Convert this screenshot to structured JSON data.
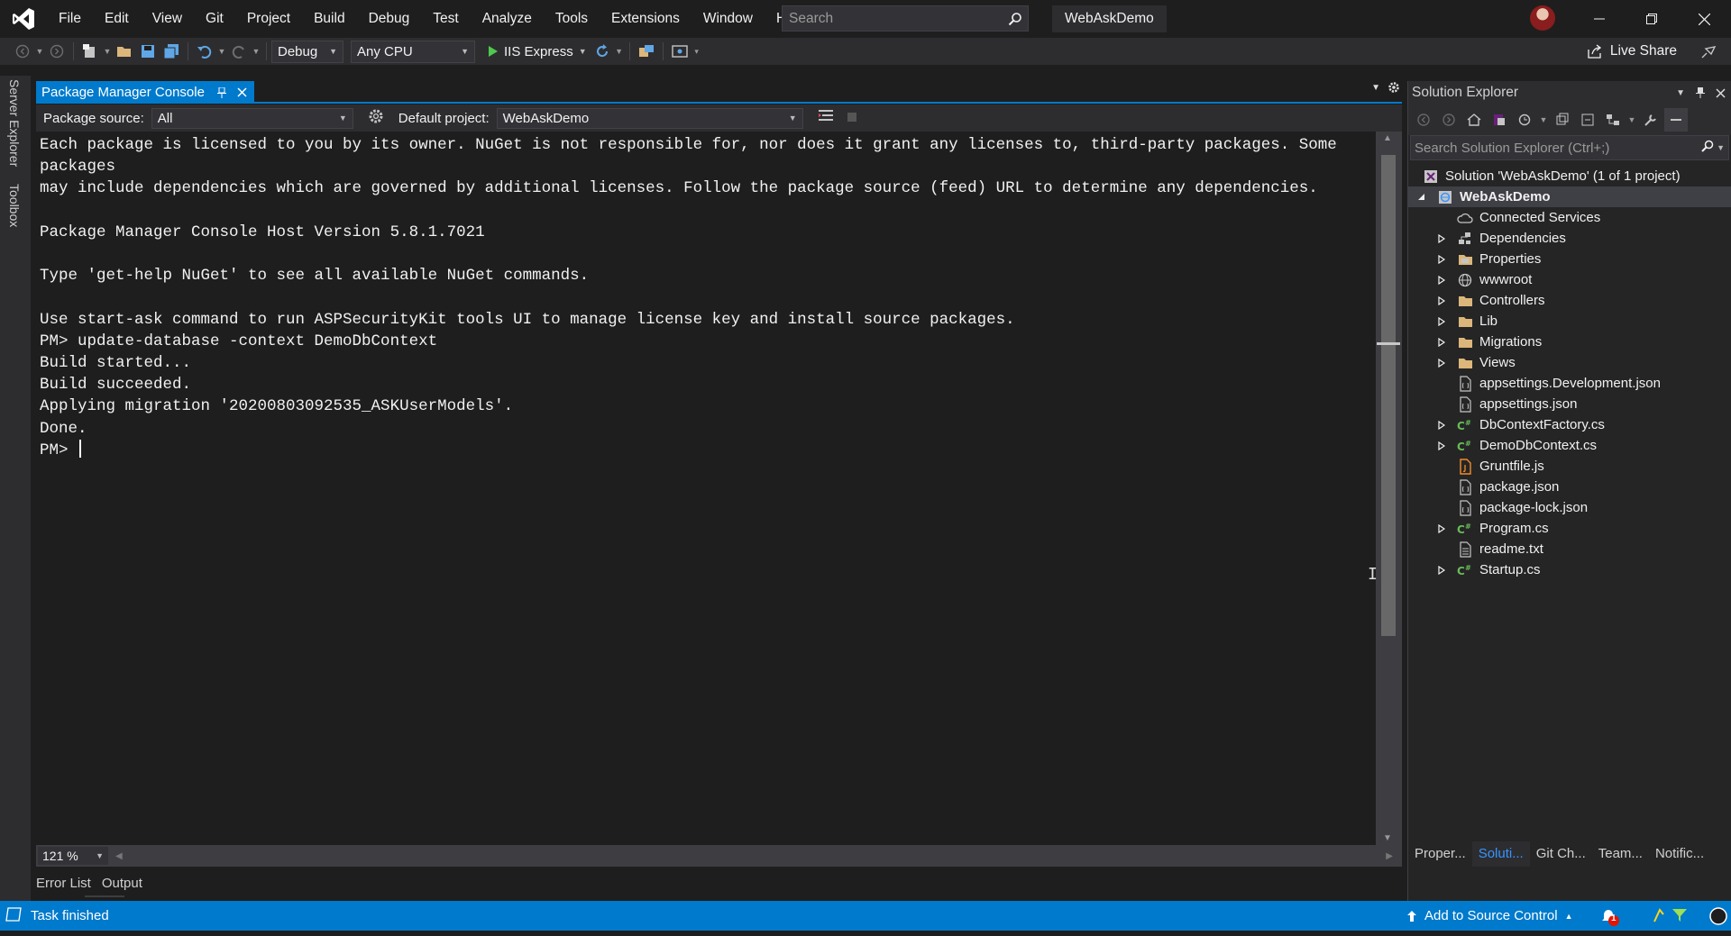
{
  "menu": [
    "File",
    "Edit",
    "View",
    "Git",
    "Project",
    "Build",
    "Debug",
    "Test",
    "Analyze",
    "Tools",
    "Extensions",
    "Window",
    "Help"
  ],
  "search": {
    "placeholder": "Search"
  },
  "solution_name": "WebAskDemo",
  "toolbar": {
    "config": "Debug",
    "platform": "Any CPU",
    "run_label": "IIS Express",
    "live_share": "Live Share"
  },
  "left_strip": {
    "server_explorer": "Server Explorer",
    "toolbox": "Toolbox"
  },
  "pmc": {
    "tab_title": "Package Manager Console",
    "package_source_label": "Package source:",
    "package_source_value": "All",
    "default_project_label": "Default project:",
    "default_project_value": "WebAskDemo",
    "zoom": "121 %",
    "lines": [
      "Each package is licensed to you by its owner. NuGet is not responsible for, nor does it grant any licenses to, third-party packages. Some packages",
      "may include dependencies which are governed by additional licenses. Follow the package source (feed) URL to determine any dependencies.",
      "",
      "Package Manager Console Host Version 5.8.1.7021",
      "",
      "Type 'get-help NuGet' to see all available NuGet commands.",
      "",
      "Use start-ask command to run ASPSecurityKit tools UI to manage license key and install source packages.",
      "PM> update-database -context DemoDbContext",
      "Build started...",
      "Build succeeded.",
      "Applying migration '20200803092535_ASKUserModels'.",
      "Done.",
      "PM> "
    ]
  },
  "bottom_tabs": [
    "Error List",
    "Output"
  ],
  "solution_explorer": {
    "title": "Solution Explorer",
    "search_placeholder": "Search Solution Explorer (Ctrl+;)",
    "solution_label": "Solution 'WebAskDemo' (1 of 1 project)",
    "project_label": "WebAskDemo",
    "items": [
      {
        "label": "Connected Services",
        "icon": "connected-services-icon",
        "expandable": false
      },
      {
        "label": "Dependencies",
        "icon": "dependencies-icon",
        "expandable": true
      },
      {
        "label": "Properties",
        "icon": "properties-folder-icon",
        "expandable": true
      },
      {
        "label": "wwwroot",
        "icon": "globe-icon",
        "expandable": true
      },
      {
        "label": "Controllers",
        "icon": "folder-icon",
        "expandable": true
      },
      {
        "label": "Lib",
        "icon": "folder-icon",
        "expandable": true
      },
      {
        "label": "Migrations",
        "icon": "folder-icon",
        "expandable": true
      },
      {
        "label": "Views",
        "icon": "folder-icon",
        "expandable": true
      },
      {
        "label": "appsettings.Development.json",
        "icon": "json-file-icon",
        "expandable": false
      },
      {
        "label": "appsettings.json",
        "icon": "json-file-icon",
        "expandable": false
      },
      {
        "label": "DbContextFactory.cs",
        "icon": "csharp-file-icon",
        "expandable": true
      },
      {
        "label": "DemoDbContext.cs",
        "icon": "csharp-file-icon",
        "expandable": true
      },
      {
        "label": "Gruntfile.js",
        "icon": "js-file-icon",
        "expandable": false
      },
      {
        "label": "package.json",
        "icon": "json-file-icon",
        "expandable": false
      },
      {
        "label": "package-lock.json",
        "icon": "json-file-icon",
        "expandable": false
      },
      {
        "label": "Program.cs",
        "icon": "csharp-file-icon",
        "expandable": true
      },
      {
        "label": "readme.txt",
        "icon": "text-file-icon",
        "expandable": false
      },
      {
        "label": "Startup.cs",
        "icon": "csharp-file-icon",
        "expandable": true
      }
    ],
    "bottom_tabs": [
      "Proper...",
      "Soluti...",
      "Git Ch...",
      "Team...",
      "Notific..."
    ],
    "active_bottom_tab": 1
  },
  "status": {
    "text": "Task finished",
    "source_control": "Add to Source Control",
    "notification_count": "1"
  },
  "colors": {
    "accent": "#007acc",
    "background": "#1e1e1e",
    "panel": "#252526",
    "folder": "#dcb67a",
    "csharp": "#68bc57"
  }
}
